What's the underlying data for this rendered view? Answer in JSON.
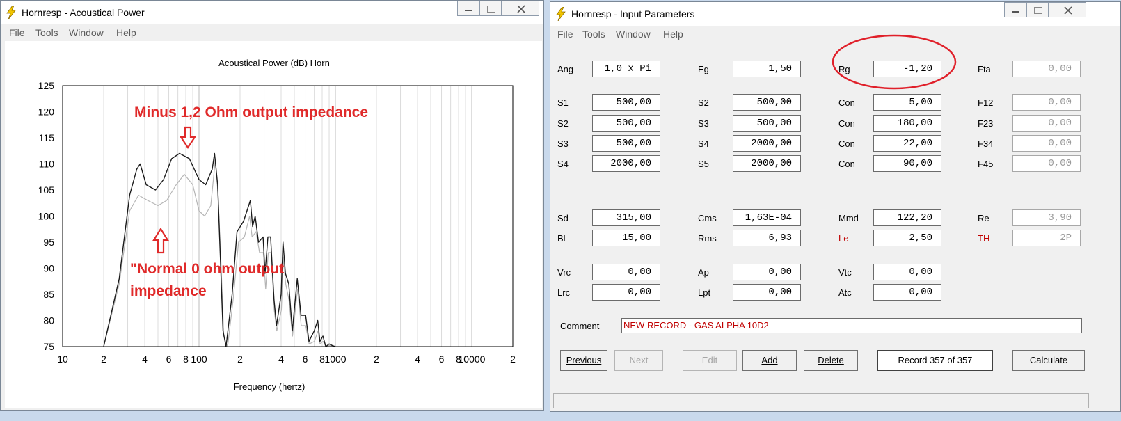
{
  "left_window": {
    "title": "Hornresp - Acoustical Power",
    "menu": [
      "File",
      "Tools",
      "Window",
      "Help"
    ],
    "annotations": {
      "top": "Minus 1,2 Ohm output impedance",
      "bottom_line1": "\"Normal 0 ohm output",
      "bottom_line2": "impedance"
    }
  },
  "chart_data": {
    "type": "line",
    "title": "Acoustical Power (dB)   Horn",
    "xlabel": "Frequency (hertz)",
    "ylabel": "",
    "x_scale": "log",
    "xlim": [
      10,
      20000
    ],
    "ylim": [
      75,
      125
    ],
    "x_tick_labels": [
      "10",
      "2",
      "4",
      "6",
      "8",
      "100",
      "2",
      "4",
      "6",
      "8",
      "1000",
      "2",
      "4",
      "6",
      "8",
      "10000",
      "2"
    ],
    "y_ticks": [
      75,
      80,
      85,
      90,
      95,
      100,
      105,
      110,
      115,
      120,
      125
    ],
    "grid": true,
    "series": [
      {
        "color": "#1a1a1a",
        "points": [
          [
            20,
            75
          ],
          [
            26,
            88
          ],
          [
            31,
            104
          ],
          [
            35,
            109
          ],
          [
            37,
            110
          ],
          [
            41,
            106
          ],
          [
            48,
            105
          ],
          [
            55,
            107
          ],
          [
            63,
            111
          ],
          [
            72,
            112
          ],
          [
            85,
            111
          ],
          [
            100,
            107
          ],
          [
            112,
            106
          ],
          [
            125,
            109
          ],
          [
            130,
            112
          ],
          [
            137,
            106
          ],
          [
            143,
            93
          ],
          [
            150,
            78
          ],
          [
            158,
            75
          ],
          [
            175,
            85
          ],
          [
            190,
            97
          ],
          [
            212,
            99
          ],
          [
            238,
            103
          ],
          [
            247,
            98
          ],
          [
            258,
            100
          ],
          [
            273,
            95
          ],
          [
            295,
            96
          ],
          [
            305,
            89
          ],
          [
            320,
            96
          ],
          [
            335,
            96
          ],
          [
            355,
            84
          ],
          [
            370,
            79
          ],
          [
            400,
            85
          ],
          [
            413,
            95
          ],
          [
            430,
            89
          ],
          [
            455,
            87
          ],
          [
            483,
            78
          ],
          [
            525,
            88
          ],
          [
            560,
            81
          ],
          [
            605,
            81
          ],
          [
            640,
            76
          ],
          [
            700,
            78
          ],
          [
            742,
            80
          ],
          [
            770,
            76
          ],
          [
            810,
            77
          ],
          [
            850,
            75
          ],
          [
            900,
            75.5
          ],
          [
            950,
            75.2
          ],
          [
            1000,
            75
          ]
        ]
      },
      {
        "color": "#b5b5b5",
        "points": [
          [
            20,
            75
          ],
          [
            26,
            87
          ],
          [
            31,
            101
          ],
          [
            36,
            104
          ],
          [
            42,
            103
          ],
          [
            50,
            102
          ],
          [
            58,
            103
          ],
          [
            68,
            106
          ],
          [
            78,
            108
          ],
          [
            90,
            106
          ],
          [
            100,
            101
          ],
          [
            110,
            100
          ],
          [
            122,
            102
          ],
          [
            132,
            111
          ],
          [
            138,
            104
          ],
          [
            145,
            91
          ],
          [
            152,
            77
          ],
          [
            162,
            75
          ],
          [
            178,
            84
          ],
          [
            195,
            95
          ],
          [
            215,
            96
          ],
          [
            235,
            100
          ],
          [
            245,
            96
          ],
          [
            262,
            97
          ],
          [
            278,
            93
          ],
          [
            296,
            93
          ],
          [
            308,
            86
          ],
          [
            322,
            93
          ],
          [
            338,
            93
          ],
          [
            356,
            82
          ],
          [
            372,
            78
          ],
          [
            402,
            82
          ],
          [
            415,
            92
          ],
          [
            432,
            87
          ],
          [
            456,
            84
          ],
          [
            485,
            77
          ],
          [
            528,
            86
          ],
          [
            562,
            79
          ],
          [
            606,
            79
          ],
          [
            642,
            75.5
          ],
          [
            702,
            76
          ],
          [
            745,
            78
          ],
          [
            772,
            75.5
          ],
          [
            812,
            76
          ],
          [
            850,
            75
          ],
          [
            900,
            75.2
          ],
          [
            1000,
            75
          ]
        ]
      }
    ]
  },
  "right_window": {
    "title": "Hornresp - Input Parameters",
    "menu": [
      "File",
      "Tools",
      "Window",
      "Help"
    ],
    "rows_top": [
      {
        "c1": {
          "label": "Ang",
          "value": "1,0 x Pi"
        },
        "c2": {
          "label": "Eg",
          "value": "1,50"
        },
        "c3": {
          "label": "Rg",
          "value": "-1,20"
        },
        "c4": {
          "label": "Fta",
          "value": "0,00"
        }
      },
      {
        "c1": {
          "label": "S1",
          "value": "500,00"
        },
        "c2": {
          "label": "S2",
          "value": "500,00"
        },
        "c3": {
          "label": "Con",
          "value": "5,00"
        },
        "c4": {
          "label": "F12",
          "value": "0,00"
        }
      },
      {
        "c1": {
          "label": "S2",
          "value": "500,00"
        },
        "c2": {
          "label": "S3",
          "value": "500,00"
        },
        "c3": {
          "label": "Con",
          "value": "180,00"
        },
        "c4": {
          "label": "F23",
          "value": "0,00"
        }
      },
      {
        "c1": {
          "label": "S3",
          "value": "500,00"
        },
        "c2": {
          "label": "S4",
          "value": "2000,00"
        },
        "c3": {
          "label": "Con",
          "value": "22,00"
        },
        "c4": {
          "label": "F34",
          "value": "0,00"
        }
      },
      {
        "c1": {
          "label": "S4",
          "value": "2000,00"
        },
        "c2": {
          "label": "S5",
          "value": "2000,00"
        },
        "c3": {
          "label": "Con",
          "value": "90,00"
        },
        "c4": {
          "label": "F45",
          "value": "0,00"
        }
      }
    ],
    "rows_driver": [
      {
        "c1": {
          "label": "Sd",
          "value": "315,00"
        },
        "c2": {
          "label": "Cms",
          "value": "1,63E-04"
        },
        "c3": {
          "label": "Mmd",
          "value": "122,20"
        },
        "c4": {
          "label": "Re",
          "value": "3,90"
        }
      },
      {
        "c1": {
          "label": "Bl",
          "value": "15,00"
        },
        "c2": {
          "label": "Rms",
          "value": "6,93"
        },
        "c3": {
          "label": "Le",
          "value": "2,50"
        },
        "c4": {
          "label": "TH",
          "value": "2P"
        }
      },
      {
        "c1": {
          "label": "Vrc",
          "value": "0,00"
        },
        "c2": {
          "label": "Ap",
          "value": "0,00"
        },
        "c3": {
          "label": "Vtc",
          "value": "0,00"
        }
      },
      {
        "c1": {
          "label": "Lrc",
          "value": "0,00"
        },
        "c2": {
          "label": "Lpt",
          "value": "0,00"
        },
        "c3": {
          "label": "Atc",
          "value": "0,00"
        }
      }
    ],
    "comment_label": "Comment",
    "comment_value": "NEW RECORD - GAS ALPHA 10D2",
    "buttons": {
      "previous": "Previous",
      "next": "Next",
      "edit": "Edit",
      "add": "Add",
      "delete": "Delete",
      "record": "Record 357 of 357",
      "calculate": "Calculate"
    }
  },
  "colors": {
    "label_red": "#c00000",
    "annotation_red": "#e02a2a",
    "highlight_ellipse": "#e0202a"
  }
}
